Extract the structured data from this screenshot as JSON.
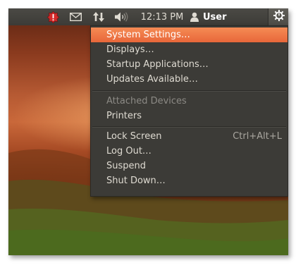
{
  "panel": {
    "indicators": [
      {
        "icon": "update-alert-icon",
        "color": "#d22a2a"
      },
      {
        "icon": "mail-icon"
      },
      {
        "icon": "network-arrows-icon"
      },
      {
        "icon": "volume-icon"
      }
    ],
    "clock": "12:13 PM",
    "user_name": "User",
    "session_icon": "gear-power-icon"
  },
  "menu": {
    "group1": {
      "system_settings": "System Settings…",
      "displays": "Displays…",
      "startup_applications": "Startup Applications…",
      "updates_available": "Updates Available…"
    },
    "group2": {
      "attached_devices": "Attached Devices",
      "printers": "Printers"
    },
    "group3": {
      "lock_screen": "Lock Screen",
      "lock_screen_shortcut": "Ctrl+Alt+L",
      "log_out": "Log Out…",
      "suspend": "Suspend",
      "shut_down": "Shut Down…"
    }
  },
  "colors": {
    "highlight": "#e8673a",
    "panel": "#3c3b37",
    "menu_bg": "#3c3b37",
    "text": "#dfdbd2",
    "disabled_text": "#8c8a85"
  }
}
